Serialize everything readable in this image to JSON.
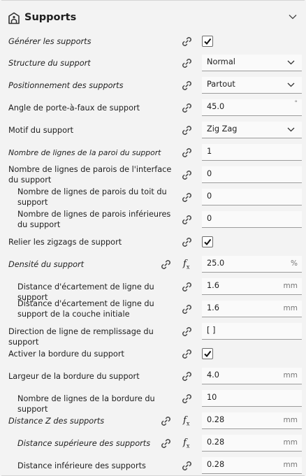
{
  "section": {
    "title": "Supports"
  },
  "colors": {
    "background": "#f3f3f3",
    "field_bg": "#fafafa",
    "field_border": "#9c9c9c",
    "text": "#1e1e1e"
  },
  "rows": [
    {
      "label": "Générer les supports"
    },
    {
      "label": "Structure du support",
      "value": "Normal"
    },
    {
      "label": "Positionnement des supports",
      "value": "Partout"
    },
    {
      "label": "Angle de porte-à-faux de support",
      "value": "45.0",
      "unit": "°"
    },
    {
      "label": "Motif du support",
      "value": "Zig Zag"
    },
    {
      "label": "Nombre de lignes de la paroi du support",
      "value": "1"
    },
    {
      "label": "Nombre de lignes de parois de l'interface du support",
      "value": "0"
    },
    {
      "label": "Nombre de lignes de parois du toit du support",
      "value": "0"
    },
    {
      "label": "Nombre de lignes de parois inférieures du support",
      "value": "0"
    },
    {
      "label": "Relier les zigzags de support"
    },
    {
      "label": "Densité du support",
      "value": "25.0",
      "unit": "%"
    },
    {
      "label": "Distance d'écartement de ligne du support",
      "value": "1.6",
      "unit": "mm"
    },
    {
      "label": "Distance d'écartement de ligne du support de la couche initiale",
      "value": "1.6",
      "unit": "mm"
    },
    {
      "label": "Direction de ligne de remplissage du support",
      "value": "[ ]"
    },
    {
      "label": "Activer la bordure du support"
    },
    {
      "label": "Largeur de la bordure du support",
      "value": "4.0",
      "unit": "mm"
    },
    {
      "label": "Nombre de lignes de la bordure du support",
      "value": "10"
    },
    {
      "label": "Distance Z des supports",
      "value": "0.28",
      "unit": "mm"
    },
    {
      "label": "Distance supérieure des supports",
      "value": "0.28",
      "unit": "mm"
    },
    {
      "label": "Distance inférieure des supports",
      "value": "0.28",
      "unit": "mm"
    }
  ]
}
